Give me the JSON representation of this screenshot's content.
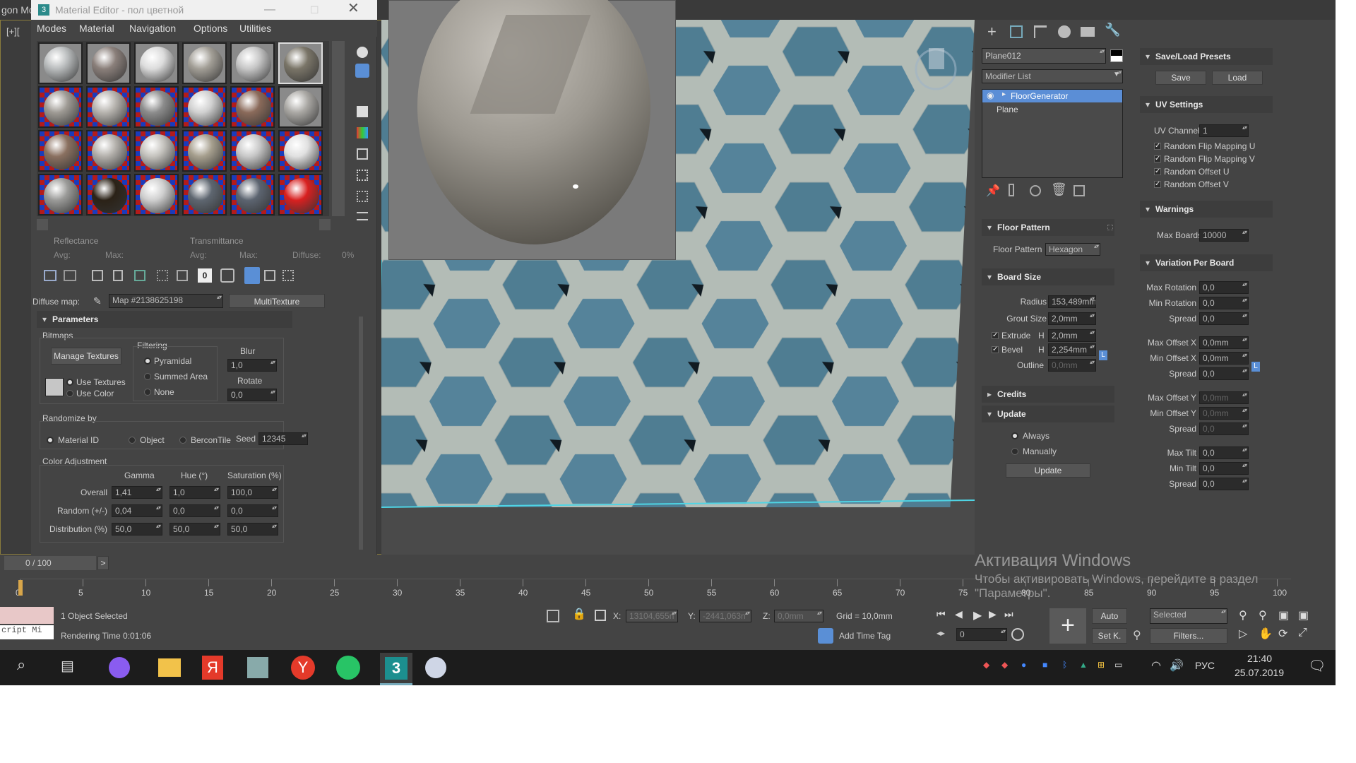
{
  "scene": {
    "title_fragment": "gon Mc",
    "viewport_label": "[+][ "
  },
  "material_editor": {
    "title": "Material Editor - пол цветной",
    "menu": [
      "Modes",
      "Material",
      "Navigation",
      "Options",
      "Utilities"
    ],
    "reflectance": {
      "label": "Reflectance",
      "avg": "Avg:",
      "max": "Max:"
    },
    "transmittance": {
      "label": "Transmittance",
      "avg": "Avg:",
      "max": "Max:",
      "diffuse": "Diffuse:",
      "pct": "0%"
    },
    "diffuse_map_label": "Diffuse map:",
    "map_name": "Map #2138625198",
    "map_type": "MultiTexture",
    "parameters_header": "Parameters",
    "bitmaps": {
      "group": "Bitmaps",
      "manage_textures": "Manage Textures",
      "use_textures": "Use Textures",
      "use_color": "Use Color",
      "filtering": "Filtering",
      "pyramidal": "Pyramidal",
      "summed_area": "Summed Area",
      "none": "None",
      "blur_label": "Blur",
      "blur_value": "1,0",
      "rotate_label": "Rotate",
      "rotate_value": "0,0"
    },
    "randomize": {
      "group": "Randomize by",
      "material_id": "Material ID",
      "object": "Object",
      "bercontile": "BerconTile",
      "seed_label": "Seed",
      "seed_value": "12345"
    },
    "color_adjustment": {
      "group": "Color Adjustment",
      "col_gamma": "Gamma",
      "col_hue": "Hue (°)",
      "col_sat": "Saturation (%)",
      "rows": [
        {
          "label": "Overall",
          "gamma": "1,41",
          "hue": "1,0",
          "sat": "100,0"
        },
        {
          "label": "Random (+/-)",
          "gamma": "0,04",
          "hue": "0,0",
          "sat": "0,0"
        },
        {
          "label": "Distribution (%)",
          "gamma": "50,0",
          "hue": "50,0",
          "sat": "50,0"
        }
      ]
    }
  },
  "command_panel": {
    "object_name": "Plane012",
    "modifier_list": "Modifier List",
    "stack": [
      "FloorGenerator",
      "Plane"
    ],
    "floor_pattern": {
      "header": "Floor Pattern",
      "label": "Floor Pattern",
      "value": "Hexagon"
    },
    "board_size": {
      "header": "Board Size",
      "radius_label": "Radius",
      "radius": "153,489mm",
      "grout_label": "Grout Size",
      "grout": "2,0mm",
      "extrude_label": "Extrude",
      "extrude_h": "H",
      "extrude": "2,0mm",
      "bevel_label": "Bevel",
      "bevel_h": "H",
      "bevel": "2,254mm",
      "outline_label": "Outline",
      "outline": "0,0mm",
      "lock": "L"
    },
    "credits_header": "Credits",
    "update": {
      "header": "Update",
      "always": "Always",
      "manually": "Manually",
      "button": "Update"
    },
    "save_load": {
      "header": "Save/Load Presets",
      "save": "Save",
      "load": "Load"
    },
    "uv_settings": {
      "header": "UV Settings",
      "channel_label": "UV Channel",
      "channel": "1",
      "checks": [
        "Random Flip Mapping U",
        "Random Flip Mapping V",
        "Random Offset U",
        "Random Offset V"
      ]
    },
    "warnings": {
      "header": "Warnings",
      "max_boards_label": "Max Boards",
      "max_boards": "10000"
    },
    "variation": {
      "header": "Variation Per Board",
      "rows": [
        {
          "label": "Max Rotation",
          "value": "0,0"
        },
        {
          "label": "Min Rotation",
          "value": "0,0"
        },
        {
          "label": "Spread",
          "value": "0,0"
        },
        {
          "label": "Max Offset X",
          "value": "0,0mm"
        },
        {
          "label": "Min Offset X",
          "value": "0,0mm"
        },
        {
          "label": "Spread",
          "value": "0,0"
        },
        {
          "label": "Max Offset Y",
          "value": "0,0mm"
        },
        {
          "label": "Min Offset Y",
          "value": "0,0mm"
        },
        {
          "label": "Spread",
          "value": "0,0"
        },
        {
          "label": "Max Tilt",
          "value": "0,0"
        },
        {
          "label": "Min Tilt",
          "value": "0,0"
        },
        {
          "label": "Spread",
          "value": "0,0"
        }
      ],
      "lock": "L"
    }
  },
  "timeline": {
    "frame_counter": "0 / 100",
    "next": ">",
    "ticks": [
      "0",
      "5",
      "10",
      "15",
      "20",
      "25",
      "30",
      "35",
      "40",
      "45",
      "50",
      "55",
      "60",
      "65",
      "70",
      "75",
      "80",
      "85",
      "90",
      "95",
      "100"
    ]
  },
  "status": {
    "script": "cript Mi",
    "selected": "1 Object Selected",
    "render_time": "Rendering Time  0:01:06",
    "x_label": "X:",
    "x": "13104,655n",
    "y_label": "Y:",
    "y": "-2441,063n",
    "z_label": "Z:",
    "z": "0,0mm",
    "grid": "Grid = 10,0mm",
    "add_time_tag": "Add Time Tag",
    "auto": "Auto",
    "setk": "Set K.",
    "selected_dd": "Selected",
    "filters": "Filters...",
    "frame": "0"
  },
  "watermark": {
    "title": "Активация Windows",
    "line": "Чтобы активировать Windows, перейдите в раздел",
    "line2": "\"Параметры\"."
  },
  "taskbar": {
    "lang": "РУС",
    "time": "21:40",
    "date": "25.07.2019"
  },
  "colors": {
    "accent": "#5a8fd6",
    "selection": "#5b8ed6",
    "floor_tile": "#4f7d92",
    "grout": "#b8bfb8"
  }
}
